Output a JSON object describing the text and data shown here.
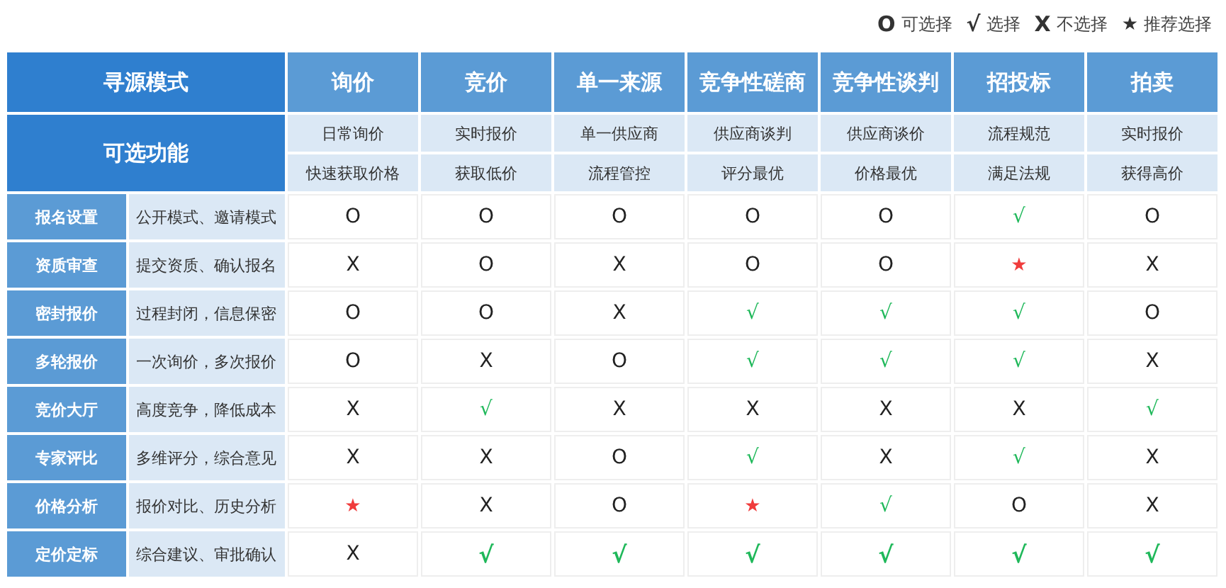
{
  "legend": [
    {
      "kind": "o",
      "symbol": "O",
      "label": "可选择"
    },
    {
      "kind": "check",
      "symbol": "√",
      "label": "选择"
    },
    {
      "kind": "x",
      "symbol": "X",
      "label": "不选择"
    },
    {
      "kind": "star",
      "symbol": "★",
      "label": "推荐选择"
    }
  ],
  "table": {
    "corner": "寻源模式",
    "features_label": "可选功能",
    "modes": [
      {
        "name": "询价",
        "features": [
          "日常询价",
          "快速获取价格"
        ]
      },
      {
        "name": "竞价",
        "features": [
          "实时报价",
          "获取低价"
        ]
      },
      {
        "name": "单一来源",
        "features": [
          "单一供应商",
          "流程管控"
        ]
      },
      {
        "name": "竞争性磋商",
        "features": [
          "供应商谈判",
          "评分最优"
        ]
      },
      {
        "name": "竞争性谈判",
        "features": [
          "供应商谈价",
          "价格最优"
        ]
      },
      {
        "name": "招投标",
        "features": [
          "流程规范",
          "满足法规"
        ]
      },
      {
        "name": "拍卖",
        "features": [
          "实时报价",
          "获得高价"
        ]
      }
    ],
    "rows": [
      {
        "name": "报名设置",
        "desc": "公开模式、邀请模式",
        "cells": [
          {
            "kind": "o",
            "text": "O"
          },
          {
            "kind": "o",
            "text": "O"
          },
          {
            "kind": "o",
            "text": "O"
          },
          {
            "kind": "o",
            "text": "O"
          },
          {
            "kind": "o",
            "text": "O"
          },
          {
            "kind": "check",
            "text": "√"
          },
          {
            "kind": "o",
            "text": "O"
          }
        ]
      },
      {
        "name": "资质审查",
        "desc": "提交资质、确认报名",
        "cells": [
          {
            "kind": "x",
            "text": "X"
          },
          {
            "kind": "o",
            "text": "O"
          },
          {
            "kind": "x",
            "text": "X"
          },
          {
            "kind": "o",
            "text": "O"
          },
          {
            "kind": "o",
            "text": "O"
          },
          {
            "kind": "star",
            "text": "★"
          },
          {
            "kind": "x",
            "text": "X"
          }
        ]
      },
      {
        "name": "密封报价",
        "desc": "过程封闭，信息保密",
        "cells": [
          {
            "kind": "o",
            "text": "O"
          },
          {
            "kind": "o",
            "text": "O"
          },
          {
            "kind": "x",
            "text": "X"
          },
          {
            "kind": "check",
            "text": "√"
          },
          {
            "kind": "check",
            "text": "√"
          },
          {
            "kind": "check",
            "text": "√"
          },
          {
            "kind": "o",
            "text": "O"
          }
        ]
      },
      {
        "name": "多轮报价",
        "desc": "一次询价，多次报价",
        "cells": [
          {
            "kind": "o",
            "text": "O"
          },
          {
            "kind": "x",
            "text": "X"
          },
          {
            "kind": "o",
            "text": "O"
          },
          {
            "kind": "check",
            "text": "√"
          },
          {
            "kind": "check",
            "text": "√"
          },
          {
            "kind": "check",
            "text": "√"
          },
          {
            "kind": "x",
            "text": "X"
          }
        ]
      },
      {
        "name": "竞价大厅",
        "desc": "高度竞争，降低成本",
        "cells": [
          {
            "kind": "x",
            "text": "X"
          },
          {
            "kind": "check",
            "text": "√"
          },
          {
            "kind": "x",
            "text": "X"
          },
          {
            "kind": "x",
            "text": "X"
          },
          {
            "kind": "x",
            "text": "X"
          },
          {
            "kind": "x",
            "text": "X"
          },
          {
            "kind": "check",
            "text": "√"
          }
        ]
      },
      {
        "name": "专家评比",
        "desc": "多维评分，综合意见",
        "cells": [
          {
            "kind": "x",
            "text": "X"
          },
          {
            "kind": "x",
            "text": "X"
          },
          {
            "kind": "o",
            "text": "O"
          },
          {
            "kind": "check",
            "text": "√"
          },
          {
            "kind": "x",
            "text": "X"
          },
          {
            "kind": "check",
            "text": "√"
          },
          {
            "kind": "x",
            "text": "X"
          }
        ]
      },
      {
        "name": "价格分析",
        "desc": "报价对比、历史分析",
        "cells": [
          {
            "kind": "star",
            "text": "★"
          },
          {
            "kind": "x",
            "text": "X"
          },
          {
            "kind": "o",
            "text": "O"
          },
          {
            "kind": "star",
            "text": "★"
          },
          {
            "kind": "check",
            "text": "√"
          },
          {
            "kind": "o",
            "text": "O"
          },
          {
            "kind": "x",
            "text": "X"
          }
        ]
      },
      {
        "name": "定价定标",
        "desc": "综合建议、审批确认",
        "cells": [
          {
            "kind": "x",
            "text": "X"
          },
          {
            "kind": "check",
            "text": "√"
          },
          {
            "kind": "check",
            "text": "√"
          },
          {
            "kind": "check",
            "text": "√"
          },
          {
            "kind": "check",
            "text": "√"
          },
          {
            "kind": "check",
            "text": "√"
          },
          {
            "kind": "check",
            "text": "√"
          }
        ]
      }
    ]
  }
}
